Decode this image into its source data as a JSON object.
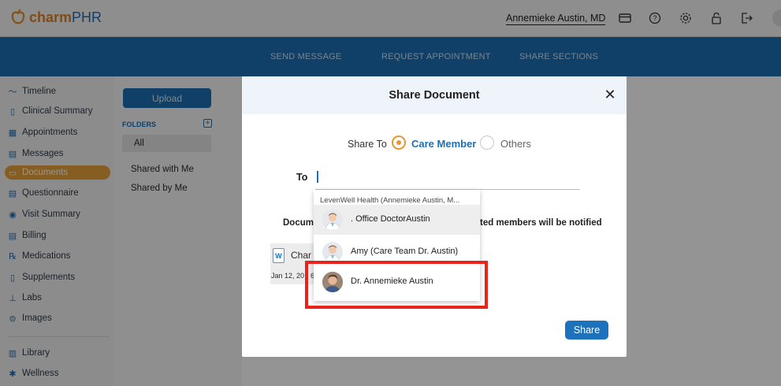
{
  "header": {
    "brand_part1": "charm",
    "brand_part2": "PHR",
    "user_name": "Annemieke Austin, MD",
    "icons": [
      "card-icon",
      "help-icon",
      "settings-icon",
      "lock-icon",
      "logout-icon"
    ]
  },
  "nav": {
    "links": [
      "SEND MESSAGE",
      "REQUEST APPOINTMENT",
      "SHARE SECTIONS"
    ]
  },
  "sidebar": {
    "items": [
      {
        "label": "Timeline",
        "icon": "timeline-icon"
      },
      {
        "label": "Clinical Summary",
        "icon": "clipboard-icon"
      },
      {
        "label": "Appointments",
        "icon": "calendar-icon"
      },
      {
        "label": "Messages",
        "icon": "message-icon"
      },
      {
        "label": "Documents",
        "icon": "folder-icon",
        "active": true
      },
      {
        "label": "Questionnaire",
        "icon": "questionnaire-icon"
      },
      {
        "label": "Visit Summary",
        "icon": "visit-icon"
      },
      {
        "label": "Billing",
        "icon": "billing-icon"
      },
      {
        "label": "Medications",
        "icon": "rx-icon"
      },
      {
        "label": "Supplements",
        "icon": "supplement-icon"
      },
      {
        "label": "Labs",
        "icon": "lab-icon"
      },
      {
        "label": "Images",
        "icon": "image-icon"
      },
      {
        "label": "Library",
        "icon": "library-icon"
      },
      {
        "label": "Wellness",
        "icon": "wellness-icon"
      }
    ]
  },
  "folders": {
    "upload_label": "Upload",
    "section_label": "FOLDERS",
    "items": [
      "All",
      "Shared with Me",
      "Shared by Me"
    ]
  },
  "modal": {
    "title": "Share Document",
    "close_glyph": "✕",
    "share_to_label": "Share To",
    "options": [
      {
        "label": "Care Member",
        "checked": true
      },
      {
        "label": "Others",
        "checked": false
      }
    ],
    "to_label": "To",
    "notify_visible_left": "Docum",
    "notify_visible_right": "ted members will be notified",
    "doc_name_partial": "Char",
    "doc_date_partial": "Jan 12, 20",
    "doc_date_tail": "6",
    "doc_icon_letter": "W",
    "share_button": "Share"
  },
  "dropdown": {
    "header": "LevenWell Health (Annemieke Austin, M...",
    "options": [
      {
        "name": ". Office DoctorAustin",
        "avatar": "doctor-avatar-icon"
      },
      {
        "name": "Amy (Care Team Dr. Austin)",
        "avatar": "doctor-avatar-icon"
      },
      {
        "name": "Dr. Annemieke Austin",
        "avatar": "photo-avatar"
      }
    ]
  },
  "colors": {
    "nav_blue": "#1d6fb1",
    "accent_orange": "#e8a23a",
    "highlight_red": "#e8231b"
  }
}
